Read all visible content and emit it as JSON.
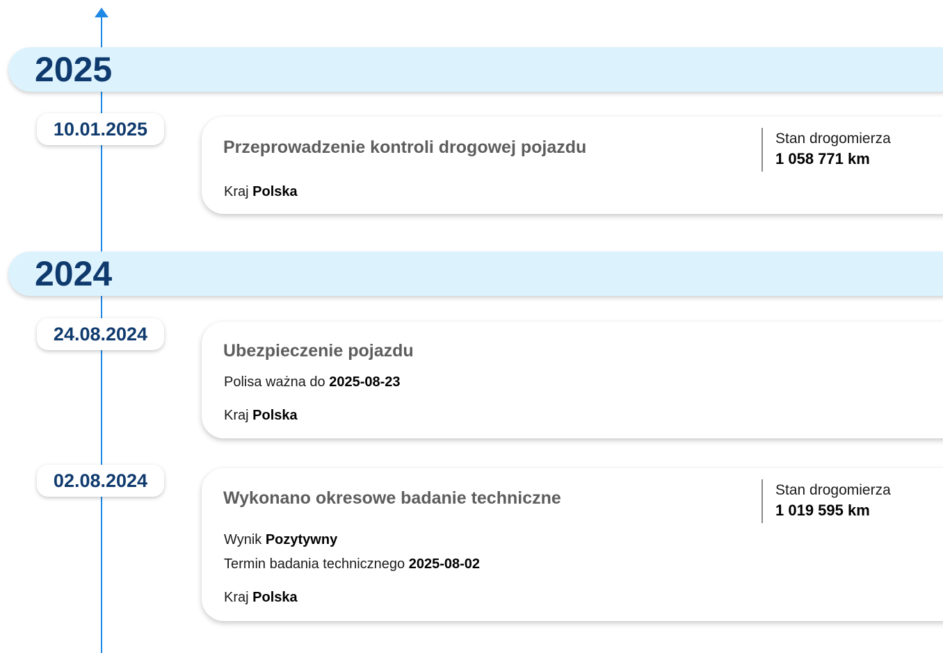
{
  "timeline": {
    "years": [
      {
        "year": "2025",
        "events": [
          {
            "date": "10.01.2025",
            "title": "Przeprowadzenie kontroli drogowej pojazdu",
            "odometer_label": "Stan drogomierza",
            "odometer_value": "1 058 771 km",
            "country_label": "Kraj",
            "country_value": "Polska"
          }
        ]
      },
      {
        "year": "2024",
        "events": [
          {
            "date": "24.08.2024",
            "title": "Ubezpieczenie pojazdu",
            "policy_label": "Polisa ważna do",
            "policy_value": "2025-08-23",
            "country_label": "Kraj",
            "country_value": "Polska"
          },
          {
            "date": "02.08.2024",
            "title": "Wykonano okresowe badanie techniczne",
            "odometer_label": "Stan drogomierza",
            "odometer_value": "1 019 595 km",
            "result_label": "Wynik",
            "result_value": "Pozytywny",
            "next_inspection_label": "Termin badania technicznego",
            "next_inspection_value": "2025-08-02",
            "country_label": "Kraj",
            "country_value": "Polska"
          }
        ]
      }
    ]
  },
  "colors": {
    "axis": "#1e88e5",
    "year_band": "#dcf2fd",
    "year_text": "#0f3a6e",
    "title_text": "#5d5d5d"
  }
}
